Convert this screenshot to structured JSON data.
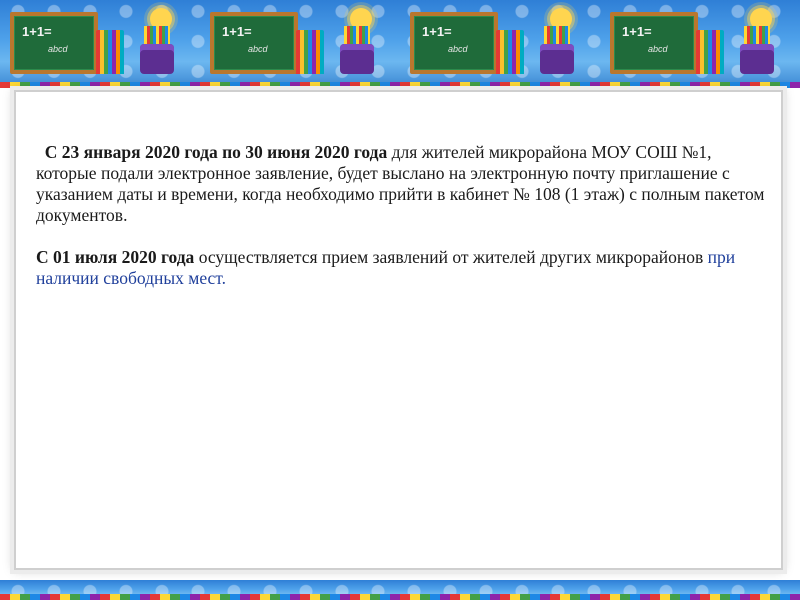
{
  "banner": {
    "board_chalk_main": "1+1=",
    "board_chalk_sub": "abcd",
    "board_icon": "chalkboard-icon",
    "sun_icon": "sun-icon",
    "pencils_icon": "pencils-icon",
    "jar_icon": "pencil-jar-icon",
    "colors": {
      "sky": "#4ea1ea",
      "board": "#1f6b3a",
      "frame": "#b9772e"
    }
  },
  "content": {
    "paragraph1": {
      "lead_bold": "С 23 января 2020 года по 30 июня 2020 года",
      "text": " для жителей микрорайона МОУ СОШ №1, которые подали электронное заявление, будет выслано на электронную почту приглашение с указанием даты и времени, когда необходимо прийти в кабинет № 108 (1 этаж) с полным пакетом документов."
    },
    "paragraph2": {
      "lead_bold": "С 01 июля 2020 года",
      "text": " осуществляется прием заявлений   от  жителей других микрорайонов ",
      "highlight": "при наличии свободных мест."
    },
    "highlight_color": "#1f3f9b"
  }
}
